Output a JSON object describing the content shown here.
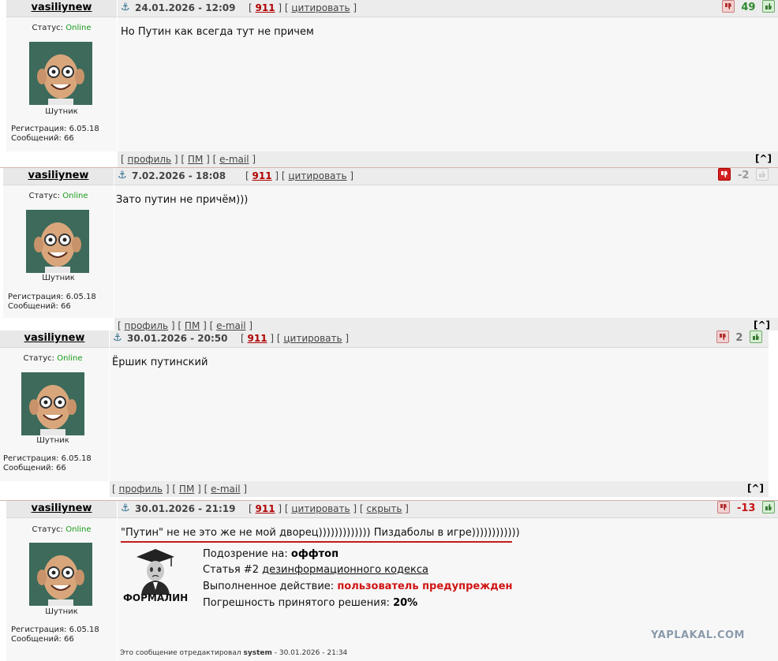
{
  "posts": [
    {
      "user": "vasiliynew",
      "status_label": "Статус:",
      "status_value": "Online",
      "rank": "Шутник",
      "reg": "Регистрация: 6.05.18",
      "msgs": "Сообщений: 66",
      "date": "24.01.2026 - 12:09",
      "num": "911",
      "quote": "цитировать",
      "rating": "49",
      "rating_color": "#2d8a2d",
      "text": "Но Путин как всегда тут не причем",
      "foot_profile": "профиль",
      "foot_pm": "ПМ",
      "foot_email": "e-mail",
      "top": "[^]"
    },
    {
      "user": "vasiliynew",
      "status_label": "Статус:",
      "status_value": "Online",
      "rank": "Шутник",
      "reg": "Регистрация: 6.05.18",
      "msgs": "Сообщений: 66",
      "date": "7.02.2026 - 18:08",
      "num": "911",
      "quote": "цитировать",
      "rating": "-2",
      "rating_color": "#9a9a9a",
      "text": "Зато путин не причём)))",
      "foot_profile": "профиль",
      "foot_pm": "ПМ",
      "foot_email": "e-mail",
      "top": "[^]"
    },
    {
      "user": "vasiliynew",
      "status_label": "Статус:",
      "status_value": "Online",
      "rank": "Шутник",
      "reg": "Регистрация: 6.05.18",
      "msgs": "Сообщений: 66",
      "date": "30.01.2026 - 20:50",
      "num": "911",
      "quote": "цитировать",
      "rating": "2",
      "rating_color": "#777777",
      "text": "Ёршик путинский",
      "foot_profile": "профиль",
      "foot_pm": "ПМ",
      "foot_email": "e-mail",
      "top": "[^]"
    },
    {
      "user": "vasiliynew",
      "status_label": "Статус:",
      "status_value": "Online",
      "rank": "Шутник",
      "reg": "Регистрация: 6.05.18",
      "msgs": "Сообщений: 66",
      "date": "30.01.2026 - 21:19",
      "num": "911",
      "quote": "цитировать",
      "hide": "скрыть",
      "rating": "-13",
      "rating_color": "#c81414",
      "text": "\"Путин\" не не это же не мой дворец))))))))))))) Пиздаболы в игре))))))))))))",
      "offtop": {
        "mod_name": "ФОРМАЛИН",
        "suspicion_label": "Подозрение на:",
        "suspicion_value": "оффтоп",
        "article_prefix": "Статья #2",
        "article_link": "дезинформационного кодекса",
        "action_label": "Выполненное действие:",
        "action_value": "пользователь предупрежден",
        "error_label": "Погрешность принятого решения:",
        "error_value": "20%"
      },
      "edited_prefix": "Это сообщение отредактировал",
      "edited_user": "system",
      "edited_date": "- 30.01.2026 - 21:34",
      "watermark": "YAPLAKAL.COM"
    }
  ]
}
